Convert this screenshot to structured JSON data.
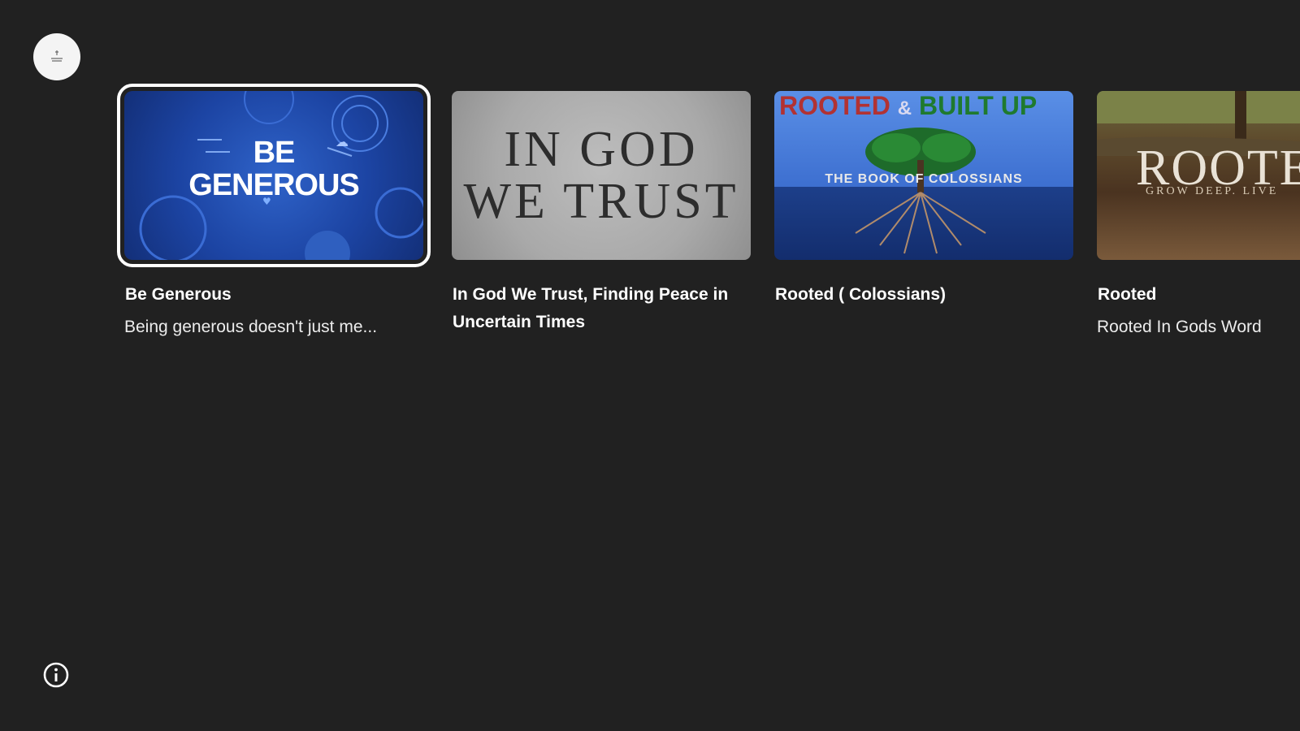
{
  "logo_icon": "church-logo-icon",
  "info_icon": "info-icon",
  "cards": [
    {
      "title": "Be Generous",
      "subtitle": "Being generous doesn't just me...",
      "thumb_text": [
        "BE",
        "GENEROUS"
      ]
    },
    {
      "title": "In God We Trust, Finding Peace in Uncertain Times",
      "subtitle": "",
      "thumb_text": [
        "IN GOD",
        "WE TRUST"
      ]
    },
    {
      "title": "Rooted ( Colossians)",
      "subtitle": "",
      "thumb_text": [
        "ROOTED",
        "&",
        "BUILT UP",
        "THE BOOK OF COLOSSIANS"
      ]
    },
    {
      "title": "Rooted",
      "subtitle": "Rooted In Gods Word",
      "thumb_text": [
        "ROOTE",
        "GROW DEEP. LIVE"
      ]
    }
  ],
  "colors": {
    "background": "#212121",
    "focus_outline": "#ffffff"
  }
}
